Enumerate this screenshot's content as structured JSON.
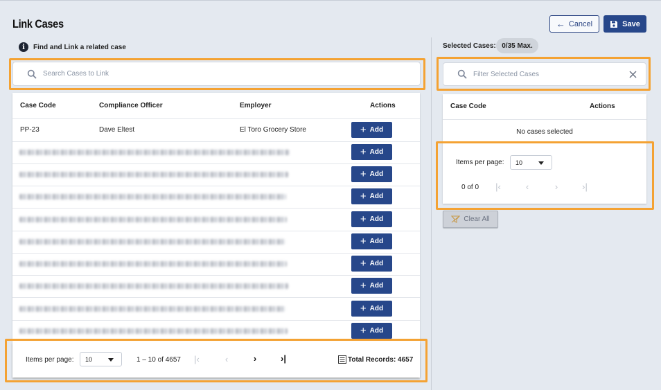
{
  "header": {
    "title": "Link Cases",
    "cancel_label": "Cancel",
    "save_label": "Save"
  },
  "left": {
    "info_text": "Find and Link a related case",
    "search_placeholder": "Search Cases to Link",
    "table": {
      "columns": [
        "Case Code",
        "Compliance Officer",
        "Employer",
        "Actions"
      ],
      "first_row": {
        "case_code": "PP-23",
        "officer": "Dave Eltest",
        "employer": "El Toro Grocery Store"
      },
      "add_label": "Add"
    },
    "pager": {
      "items_per_page_label": "Items per page:",
      "items_per_page_value": "10",
      "range": "1 – 10 of 4657",
      "total_records": "Total Records: 4657"
    }
  },
  "right": {
    "selected_label": "Selected Cases:",
    "selected_count": "0/35 Max.",
    "filter_placeholder": "Filter Selected Cases",
    "table": {
      "columns": [
        "Case Code",
        "Actions"
      ],
      "empty_text": "No cases selected"
    },
    "pager": {
      "items_per_page_label": "Items per page:",
      "items_per_page_value": "10",
      "range": "0 of 0"
    },
    "clear_all_label": "Clear All"
  },
  "colors": {
    "primary": "#27478a",
    "highlight": "#f4a233",
    "background": "#e4e9f0"
  }
}
